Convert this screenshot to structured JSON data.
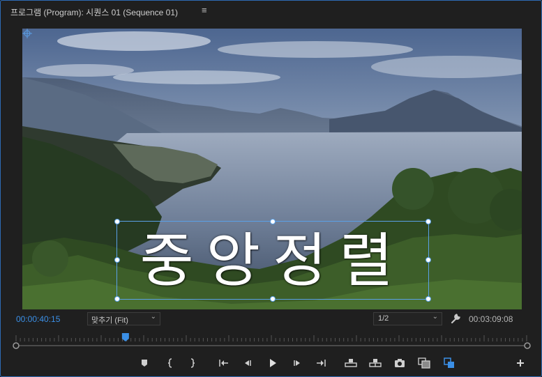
{
  "panel": {
    "title": "프로그램 (Program): 시퀀스 01 (Sequence 01)",
    "menu_icon": "hamburger-menu-icon"
  },
  "viewer": {
    "title_text": "중앙정렬",
    "bounding_box_color": "#5aa0e8"
  },
  "status_bar": {
    "current_timecode": "00:00:40:15",
    "zoom_value": "맞추기 (Fit)",
    "resolution_value": "1/2",
    "duration_timecode": "00:03:09:08",
    "settings_icon": "wrench-icon"
  },
  "timeline": {
    "playhead_color": "#3b8fe6",
    "playhead_position_fraction": 0.214
  },
  "transport": {
    "buttons": [
      "add-marker-icon",
      "mark-in-icon",
      "mark-out-icon",
      "go-to-in-icon",
      "step-back-icon",
      "play-icon",
      "step-forward-icon",
      "go-to-out-icon",
      "lift-icon",
      "extract-icon",
      "export-frame-icon",
      "comparison-view-icon",
      "insert-overwrite-icon",
      "add-button-icon"
    ]
  },
  "colors": {
    "accent": "#3b8fe6",
    "background": "#1f1f1f",
    "border": "#2d6bb5"
  }
}
